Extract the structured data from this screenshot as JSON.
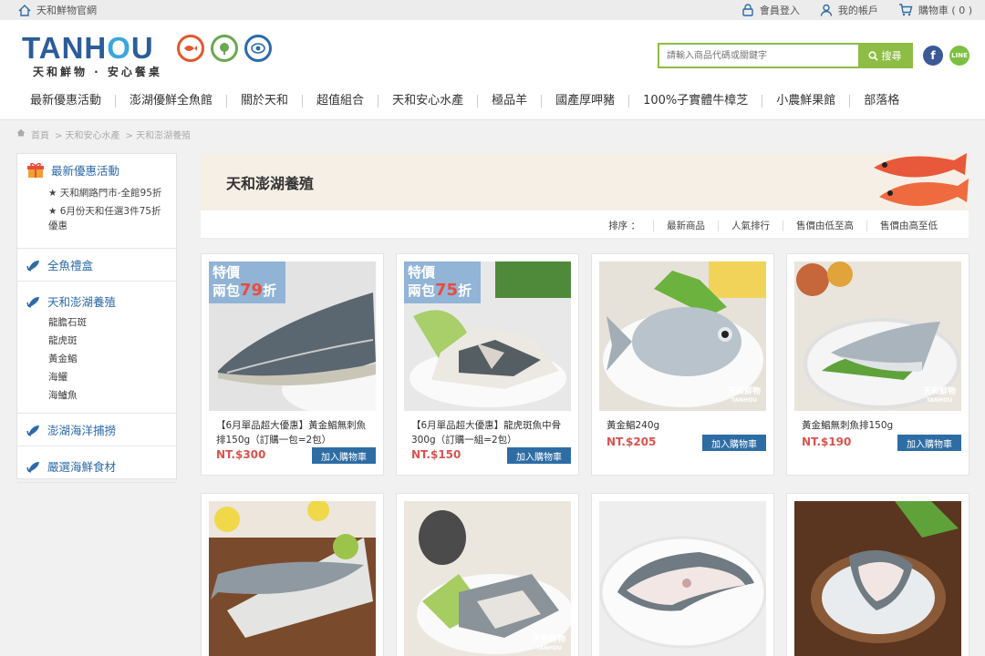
{
  "topbar": {
    "site_link": "天和鮮物官網",
    "login": "會員登入",
    "account": "我的帳戶",
    "cart": "購物車 ( 0 )"
  },
  "brand": {
    "logo_main": "TANHOU",
    "tagline": "天和鮮物 · 安心餐桌",
    "badges": [
      "認證",
      "溯源",
      "檢驗"
    ]
  },
  "search": {
    "placeholder": "請輸入商品代碼或關鍵字",
    "button": "搜尋"
  },
  "social": {
    "facebook": "f",
    "line": "LINE"
  },
  "nav": [
    "最新優惠活動",
    "澎湖優鮮全魚館",
    "關於天和",
    "超值組合",
    "天和安心水產",
    "極品羊",
    "國產厚呷豬",
    "100%子實體牛樟芝",
    "小農鮮果館",
    "部落格"
  ],
  "breadcrumb": [
    "首頁",
    "> 天和安心水產",
    "> 天和澎湖養殖"
  ],
  "sidebar": {
    "promo": {
      "title": "最新優惠活動",
      "items": [
        "★ 天和網路門市-全館95折",
        "★ 6月份天和任選3件75折優惠"
      ]
    },
    "sections": [
      {
        "title": "全魚禮盒",
        "items": []
      },
      {
        "title": "天和澎湖養殖",
        "items": [
          "龍膽石斑",
          "龍虎斑",
          "黃金鯧",
          "海鱺",
          "海鱸魚"
        ]
      },
      {
        "title": "澎湖海洋捕撈",
        "items": []
      },
      {
        "title": "嚴選海鮮食材",
        "items": []
      }
    ]
  },
  "category": {
    "title": "天和澎湖養殖"
  },
  "sort": {
    "label": "排序 ：",
    "options": [
      "最新商品",
      "人氣排行",
      "售價由低至高",
      "售價由高至低"
    ]
  },
  "products": [
    {
      "name": "【6月單品超大優惠】黃金鯧無刺魚排150g（訂購一包=2包）",
      "price": "NT.$300",
      "button": "加入購物車",
      "tag_line1": "特價",
      "tag_line2a": "兩包",
      "tag_num": "79",
      "tag_line2b": "折"
    },
    {
      "name": "【6月單品超大優惠】龍虎斑魚中骨300g（訂購一組=2包）",
      "price": "NT.$150",
      "button": "加入購物車",
      "tag_line1": "特價",
      "tag_line2a": "兩包",
      "tag_num": "75",
      "tag_line2b": "折"
    },
    {
      "name": "黃金鯧240g",
      "price": "NT.$205",
      "button": "加入購物車"
    },
    {
      "name": "黃金鯧無刺魚排150g",
      "price": "NT.$190",
      "button": "加入購物車"
    }
  ],
  "watermark": {
    "cn": "天和鮮物",
    "en": "TANHOU"
  },
  "colors": {
    "brand_blue": "#2b5d9a",
    "search_green": "#8dbd44",
    "price_red": "#d9534f",
    "button_blue": "#2e6da4"
  }
}
